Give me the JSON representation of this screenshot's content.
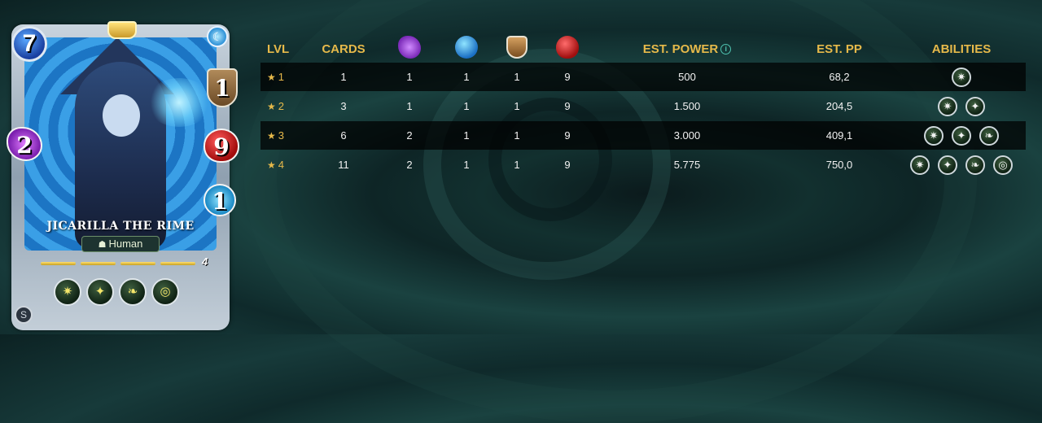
{
  "card": {
    "name": "JICARILLA THE RIME",
    "mana": "7",
    "armor": "1",
    "health": "9",
    "speed": "1",
    "magic": "2",
    "type": "Human",
    "level": "4",
    "element_icon": "water-element-icon",
    "abilities": [
      {
        "icon": "blast-ability-icon",
        "glyph": "✷"
      },
      {
        "icon": "sparkle-ability-icon",
        "glyph": "✦"
      },
      {
        "icon": "leaf-ability-icon",
        "glyph": "❧"
      },
      {
        "icon": "vortex-ability-icon",
        "glyph": "◎"
      }
    ]
  },
  "table": {
    "headers": {
      "lvl": "LVL",
      "cards": "CARDS",
      "magic_icon": "magic-icon",
      "speed_icon": "speed-icon",
      "armor_icon": "armor-icon",
      "health_icon": "health-icon",
      "est_power": "EST. POWER",
      "est_pp": "EST. PP",
      "abilities": "ABILITIES"
    },
    "rows": [
      {
        "lvl": "1",
        "cards": "1",
        "magic": "1",
        "speed": "1",
        "armor": "1",
        "health": "9",
        "power": "500",
        "pp": "68,2",
        "ability_count": 1
      },
      {
        "lvl": "2",
        "cards": "3",
        "magic": "1",
        "speed": "1",
        "armor": "1",
        "health": "9",
        "power": "1.500",
        "pp": "204,5",
        "ability_count": 2
      },
      {
        "lvl": "3",
        "cards": "6",
        "magic": "2",
        "speed": "1",
        "armor": "1",
        "health": "9",
        "power": "3.000",
        "pp": "409,1",
        "ability_count": 3
      },
      {
        "lvl": "4",
        "cards": "11",
        "magic": "2",
        "speed": "1",
        "armor": "1",
        "health": "9",
        "power": "5.775",
        "pp": "750,0",
        "ability_count": 4
      }
    ]
  }
}
